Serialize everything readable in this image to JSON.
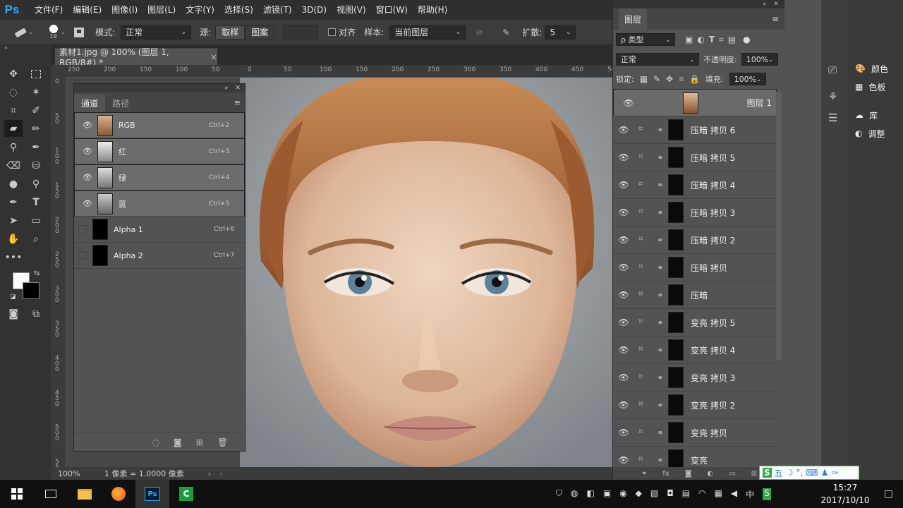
{
  "app": {
    "logo": "Ps"
  },
  "menu": [
    "文件(F)",
    "编辑(E)",
    "图像(I)",
    "图层(L)",
    "文字(Y)",
    "选择(S)",
    "滤镜(T)",
    "3D(D)",
    "视图(V)",
    "窗口(W)",
    "帮助(H)"
  ],
  "options": {
    "brush_size": "19",
    "mode_label": "模式:",
    "mode_value": "正常",
    "source_label": "源:",
    "source_sample": "取样",
    "source_pattern": "图案",
    "align_label": "对齐",
    "sample_label": "样本:",
    "sample_value": "当前图层",
    "diffuse_label": "扩散:",
    "diffuse_value": "5"
  },
  "doc_tab": {
    "title": "素材1.jpg @ 100% (图层 1, RGB/8#) *",
    "close": "×"
  },
  "ruler": {
    "h_labels": [
      "250",
      "200",
      "150",
      "100",
      "50",
      "0",
      "50",
      "100",
      "150",
      "200",
      "250",
      "300",
      "350",
      "400",
      "450",
      "500"
    ],
    "v_labels": [
      "0",
      "5 0",
      "1 0 0",
      "1 5 0",
      "2 0 0",
      "2 5 0",
      "3 0 0",
      "3 5 0",
      "4 0 0",
      "4 5 0",
      "5 0 0",
      "5 5 0"
    ]
  },
  "channels_panel": {
    "tabs": [
      "通道",
      "路径"
    ],
    "channels": [
      {
        "name": "RGB",
        "shortcut": "Ctrl+2",
        "visible": true
      },
      {
        "name": "红",
        "shortcut": "Ctrl+3",
        "visible": true
      },
      {
        "name": "绿",
        "shortcut": "Ctrl+4",
        "visible": true
      },
      {
        "name": "蓝",
        "shortcut": "Ctrl+5",
        "visible": true
      },
      {
        "name": "Alpha 1",
        "shortcut": "Ctrl+6",
        "visible": false
      },
      {
        "name": "Alpha 2",
        "shortcut": "Ctrl+7",
        "visible": false
      }
    ]
  },
  "status": {
    "zoom": "100%",
    "info": "1 像素 = 1.0000 像素"
  },
  "layers_panel": {
    "title": "图层",
    "filter_label": "ρ 类型",
    "blend_mode": "正常",
    "opacity_label": "不透明度:",
    "opacity": "100%",
    "lock_label": "锁定:",
    "fill_label": "填充:",
    "fill": "100%",
    "layers": [
      {
        "name": "图层 1",
        "type": "pixel"
      },
      {
        "name": "压暗 拷贝 6",
        "type": "curves"
      },
      {
        "name": "压暗 拷贝 5",
        "type": "curves"
      },
      {
        "name": "压暗 拷贝 4",
        "type": "curves"
      },
      {
        "name": "压暗 拷贝 3",
        "type": "curves"
      },
      {
        "name": "压暗 拷贝 2",
        "type": "curves"
      },
      {
        "name": "压暗 拷贝",
        "type": "curves"
      },
      {
        "name": "压暗",
        "type": "curves"
      },
      {
        "name": "变亮 拷贝 5",
        "type": "curves"
      },
      {
        "name": "变亮 拷贝 4",
        "type": "curves"
      },
      {
        "name": "变亮 拷贝 3",
        "type": "curves"
      },
      {
        "name": "变亮 拷贝 2",
        "type": "curves"
      },
      {
        "name": "变亮 拷贝",
        "type": "curves"
      },
      {
        "name": "变亮",
        "type": "curves"
      }
    ],
    "footer": [
      "fx"
    ]
  },
  "right_panels": [
    {
      "label": "颜色",
      "icon": "palette-icon"
    },
    {
      "label": "色板",
      "icon": "grid-icon"
    },
    {
      "label": "库",
      "icon": "cloud-icon"
    },
    {
      "label": "调整",
      "icon": "contrast-icon"
    }
  ],
  "ime": {
    "label": "五"
  },
  "clock": {
    "time": "15:27",
    "date": "2017/10/10"
  },
  "colors": {
    "accent": "#31a8ff",
    "panel": "#535353",
    "dark": "#323232"
  }
}
